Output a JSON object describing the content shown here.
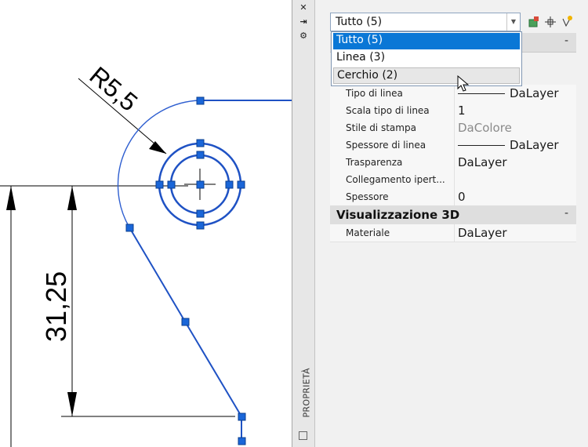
{
  "dimensions": {
    "vertical": "31,25",
    "radius": "R5,5"
  },
  "palette": {
    "title": "PROPRIETÀ",
    "bar_buttons": [
      "✕",
      "⇥",
      "⚙"
    ],
    "selector": {
      "value": "Tutto (5)"
    },
    "dropdown_options": [
      "Tutto (5)",
      "Linea (3)",
      "Cerchio (2)"
    ],
    "section_general_collapse": "-",
    "rows": [
      {
        "key": "Tipo di linea",
        "value": "DaLayer",
        "swatch": true
      },
      {
        "key": "Scala tipo di linea",
        "value": "1"
      },
      {
        "key": "Stile di stampa",
        "value": "DaColore",
        "muted": true
      },
      {
        "key": "Spessore di linea",
        "value": "DaLayer",
        "swatch": true
      },
      {
        "key": "Trasparenza",
        "value": "DaLayer"
      },
      {
        "key": "Collegamento ipert...",
        "value": ""
      },
      {
        "key": "Spessore",
        "value": "0"
      }
    ],
    "section_3d": {
      "title": "Visualizzazione 3D",
      "collapse": "-"
    },
    "rows_3d": [
      {
        "key": "Materiale",
        "value": "DaLayer"
      }
    ]
  },
  "colors": {
    "selection_blue": "#0a77d6",
    "geometry_blue": "#1f52c4",
    "grip_blue": "#1a66d8"
  }
}
